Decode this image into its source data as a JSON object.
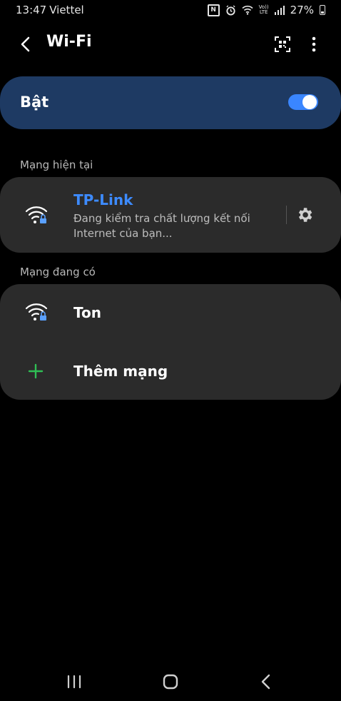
{
  "status_bar": {
    "time": "13:47",
    "carrier": "Viettel",
    "volte_top": "Vo))",
    "volte_bottom": "LTE",
    "battery": "27%"
  },
  "app_bar": {
    "title": "Wi-Fi",
    "back_icon": "chevron-left-icon",
    "qr_icon": "qr-scan-icon",
    "more_icon": "more-vert-icon"
  },
  "wifi_toggle": {
    "label": "Bật",
    "enabled": true,
    "accent": "#3a86ff",
    "card_color": "#1e3a63"
  },
  "current_network": {
    "header": "Mạng hiện tại",
    "name": "TP-Link",
    "name_color": "#3d8bff",
    "status": "Đang kiểm tra chất lượng kết nối Internet của bạn...",
    "icon": "wifi-lock-icon",
    "settings_icon": "gear-icon"
  },
  "available_networks": {
    "header": "Mạng đang có",
    "items": [
      {
        "name": "Ton",
        "icon": "wifi-lock-icon"
      }
    ],
    "add_label": "Thêm mạng",
    "add_icon": "plus-icon",
    "add_color": "#2fbf55"
  },
  "nav_bar": {
    "recents_icon": "recents-icon",
    "home_icon": "home-icon",
    "back_icon": "back-icon"
  }
}
